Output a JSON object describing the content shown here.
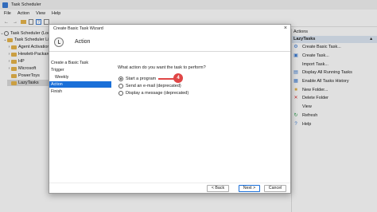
{
  "window": {
    "title": "Task Scheduler"
  },
  "menu": [
    "File",
    "Action",
    "View",
    "Help"
  ],
  "tree": {
    "root": "Task Scheduler (Local)",
    "library": "Task Scheduler Library",
    "folders": [
      "Agent Activation",
      "Hewlett-Packard",
      "HP",
      "Microsoft",
      "PowerToys",
      "LazyTasks"
    ]
  },
  "actions_pane": {
    "title": "Actions",
    "group": "LazyTasks",
    "items": [
      {
        "label": "Create Basic Task...",
        "icon": "wizard-icon"
      },
      {
        "label": "Create Task...",
        "icon": "task-icon"
      },
      {
        "label": "Import Task...",
        "icon": "import-icon"
      },
      {
        "label": "Display All Running Tasks",
        "icon": "running-icon"
      },
      {
        "label": "Enable All Tasks History",
        "icon": "history-icon"
      },
      {
        "label": "New Folder...",
        "icon": "new-folder-icon"
      },
      {
        "label": "Delete Folder",
        "icon": "delete-icon"
      },
      {
        "label": "View",
        "icon": "view-icon"
      },
      {
        "label": "Refresh",
        "icon": "refresh-icon"
      },
      {
        "label": "Help",
        "icon": "help-icon"
      }
    ]
  },
  "wizard": {
    "title": "Create Basic Task Wizard",
    "header": "Action",
    "steps": [
      {
        "label": "Create a Basic Task",
        "sub": false
      },
      {
        "label": "Trigger",
        "sub": false
      },
      {
        "label": "Weekly",
        "sub": true
      },
      {
        "label": "Action",
        "sub": false,
        "current": true
      },
      {
        "label": "Finish",
        "sub": false
      }
    ],
    "question": "What action do you want the task to perform?",
    "options": [
      {
        "label": "Start a program",
        "checked": true
      },
      {
        "label": "Send an e-mail (deprecated)",
        "checked": false
      },
      {
        "label": "Display a message (deprecated)",
        "checked": false
      }
    ],
    "callout": "4",
    "buttons": {
      "back": "< Back",
      "next": "Next >",
      "cancel": "Cancel"
    }
  },
  "colors": {
    "accent": "#1a6fd8",
    "callout": "#e04646",
    "folder": "#e8b64c"
  }
}
